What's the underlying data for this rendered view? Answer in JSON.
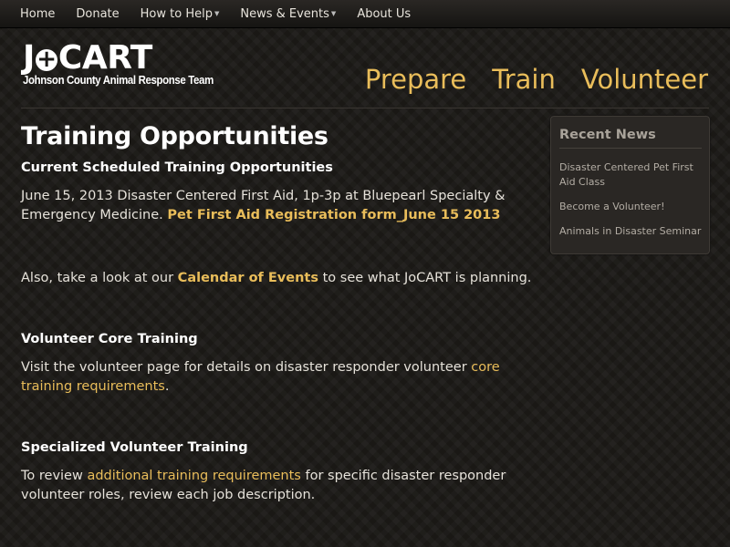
{
  "topnav": {
    "items": [
      {
        "label": "Home",
        "dropdown": false
      },
      {
        "label": "Donate",
        "dropdown": false
      },
      {
        "label": "How to Help",
        "dropdown": true
      },
      {
        "label": "News & Events",
        "dropdown": true
      },
      {
        "label": "About Us",
        "dropdown": false
      }
    ]
  },
  "header": {
    "logo_left": "J",
    "logo_o": "o",
    "logo_right": "CART",
    "logo_sub": "Johnson County Animal Response Team",
    "nav": [
      "Prepare",
      "Train",
      "Volunteer"
    ]
  },
  "main": {
    "title": "Training Opportunities",
    "section1_heading": "Current Scheduled Training Opportunities",
    "section1_text": "June 15, 2013 Disaster Centered First Aid, 1p-3p at Bluepearl Specialty & Emergency Medicine.",
    "section1_link": "Pet First Aid Registration form_June 15 2013",
    "also_pre": "Also, take a look at our",
    "also_link": "Calendar of Events",
    "also_post": "to see what JoCART is planning.",
    "section2_heading": "Volunteer Core Training",
    "section2_pre": "Visit the volunteer page for details on disaster responder volunteer",
    "section2_link": "core training requirements",
    "section2_post": ".",
    "section3_heading": "Specialized Volunteer Training",
    "section3_pre": "To review",
    "section3_link": "additional training requirements",
    "section3_post": "for specific disaster responder volunteer roles, review each job description."
  },
  "sidebar": {
    "title": "Recent News",
    "items": [
      "Disaster Centered Pet First Aid Class",
      "Become a Volunteer!",
      "Animals in Disaster Seminar"
    ]
  },
  "colors": {
    "accent": "#e9bd5a",
    "background": "#1c1a17"
  }
}
